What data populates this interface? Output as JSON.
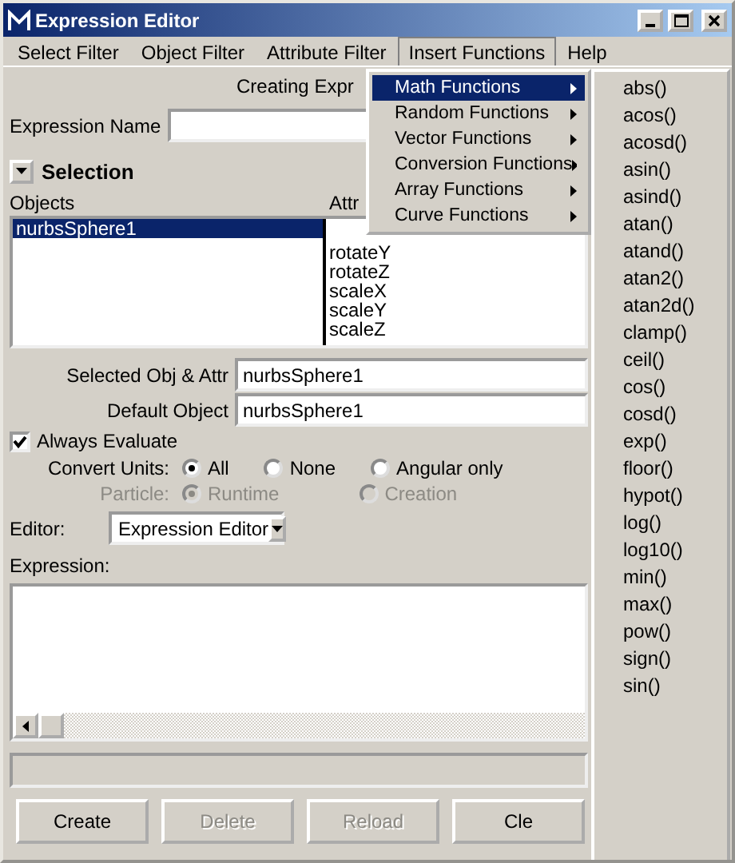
{
  "window": {
    "title": "Expression Editor"
  },
  "menubar": [
    {
      "label": "Select Filter",
      "selected": false
    },
    {
      "label": "Object Filter",
      "selected": false
    },
    {
      "label": "Attribute Filter",
      "selected": false
    },
    {
      "label": "Insert Functions",
      "selected": true
    },
    {
      "label": "Help",
      "selected": false
    }
  ],
  "dropdown": [
    {
      "label": "Math Functions",
      "selected": true,
      "has_submenu": true
    },
    {
      "label": "Random Functions",
      "selected": false,
      "has_submenu": true
    },
    {
      "label": "Vector Functions",
      "selected": false,
      "has_submenu": true
    },
    {
      "label": "Conversion Functions",
      "selected": false,
      "has_submenu": true
    },
    {
      "label": "Array Functions",
      "selected": false,
      "has_submenu": true
    },
    {
      "label": "Curve Functions",
      "selected": false,
      "has_submenu": true
    }
  ],
  "submenu": [
    "abs()",
    "acos()",
    "acosd()",
    "asin()",
    "asind()",
    "atan()",
    "atand()",
    "atan2()",
    "atan2d()",
    "clamp()",
    "ceil()",
    "cos()",
    "cosd()",
    "exp()",
    "floor()",
    "hypot()",
    "log()",
    "log10()",
    "min()",
    "max()",
    "pow()",
    "sign()",
    "sin()"
  ],
  "header_text": "Creating Expr",
  "expression_name": {
    "label": "Expression Name"
  },
  "selection": {
    "title": "Selection",
    "expanded": true
  },
  "objects": {
    "label": "Objects",
    "items": [
      {
        "label": "nurbsSphere1",
        "selected": true
      }
    ]
  },
  "attributes": {
    "label": "Attr",
    "items": [
      {
        "label": "rotateY",
        "selected": false
      },
      {
        "label": "rotateZ",
        "selected": false
      },
      {
        "label": "scaleX",
        "selected": false
      },
      {
        "label": "scaleY",
        "selected": false
      },
      {
        "label": "scaleZ",
        "selected": false
      }
    ]
  },
  "fields": [
    {
      "label": "Selected Obj & Attr",
      "value": "nurbsSphere1"
    },
    {
      "label": "Default Object",
      "value": "nurbsSphere1"
    }
  ],
  "always_evaluate": {
    "label": "Always Evaluate",
    "checked": true
  },
  "convert_units": {
    "label": "Convert Units:",
    "disabled": false,
    "options": [
      {
        "label": "All",
        "selected": true
      },
      {
        "label": "None",
        "selected": false
      },
      {
        "label": "Angular only",
        "selected": false
      }
    ]
  },
  "particle": {
    "label": "Particle:",
    "disabled": true,
    "options": [
      {
        "label": "Runtime",
        "selected": true
      },
      {
        "label": "Creation",
        "selected": false
      }
    ]
  },
  "editor": {
    "label": "Editor:",
    "value": "Expression Editor"
  },
  "expression": {
    "label": "Expression:"
  },
  "buttons": [
    {
      "label": "Create",
      "disabled": false
    },
    {
      "label": "Delete",
      "disabled": true
    },
    {
      "label": "Reload",
      "disabled": true
    },
    {
      "label": "Cle",
      "disabled": false
    }
  ]
}
